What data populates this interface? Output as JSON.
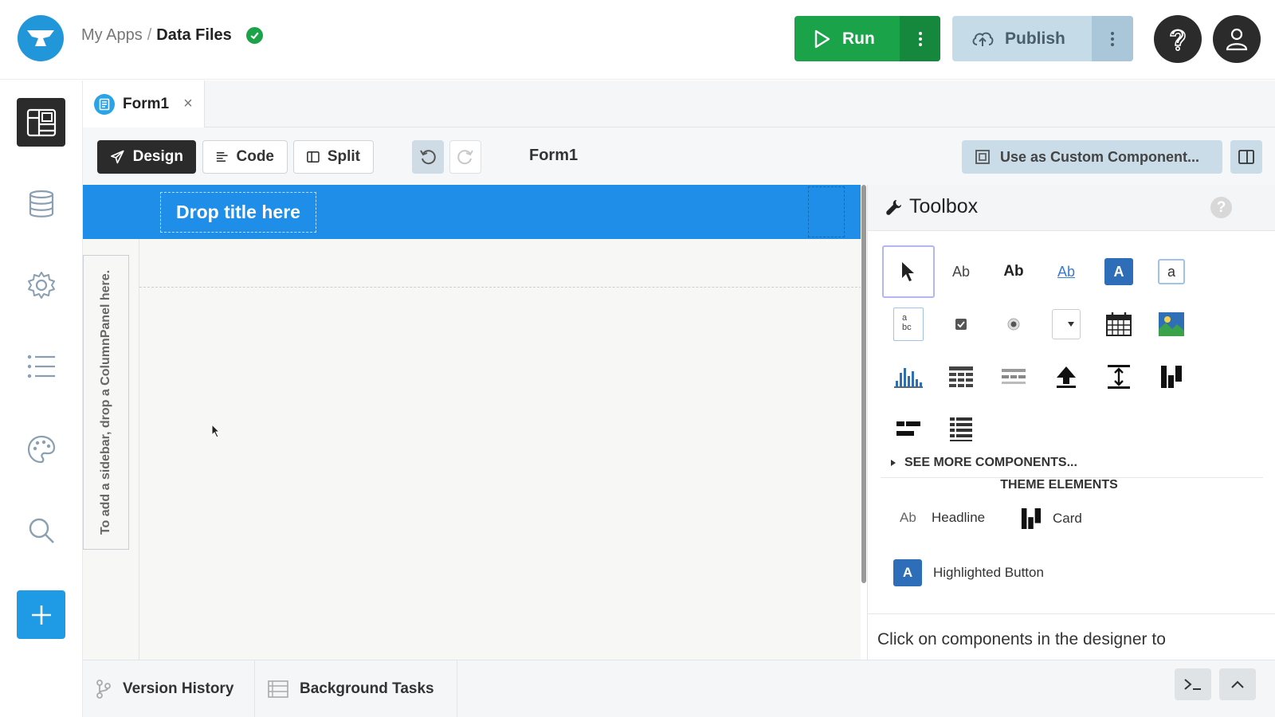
{
  "breadcrumb": {
    "parent": "My Apps",
    "separator": "/",
    "current": "Data Files"
  },
  "header": {
    "run_label": "Run",
    "publish_label": "Publish"
  },
  "tabs": [
    {
      "label": "Form1",
      "close": "×"
    }
  ],
  "toolbar": {
    "design_label": "Design",
    "code_label": "Code",
    "split_label": "Split",
    "form_name": "Form1",
    "custom_component_label": "Use as Custom Component..."
  },
  "canvas": {
    "title_placeholder": "Drop title here",
    "sidebar_hint": "To add a sidebar, drop a ColumnPanel here."
  },
  "toolbox": {
    "title": "Toolbox",
    "help": "?",
    "tool_glyphs": {
      "label": "Ab",
      "bold_label": "Ab",
      "link": "Ab",
      "button": "A",
      "textbox": "a",
      "textarea_top": "a",
      "textarea_bottom": "bc"
    },
    "see_more": "SEE MORE COMPONENTS...",
    "theme_heading": "THEME ELEMENTS",
    "theme_items": [
      {
        "glyph": "Ab",
        "label": "Headline"
      },
      {
        "label": "Card"
      },
      {
        "glyph": "A",
        "label": "Highlighted Button"
      }
    ],
    "footer_text": "Click on components in the designer to"
  },
  "bottom": {
    "version_history": "Version History",
    "background_tasks": "Background Tasks"
  },
  "colors": {
    "run": "#1ba34a",
    "accent_blue": "#1f8ee8",
    "publish": "#c5dbe8",
    "dark": "#2b2b2b"
  }
}
